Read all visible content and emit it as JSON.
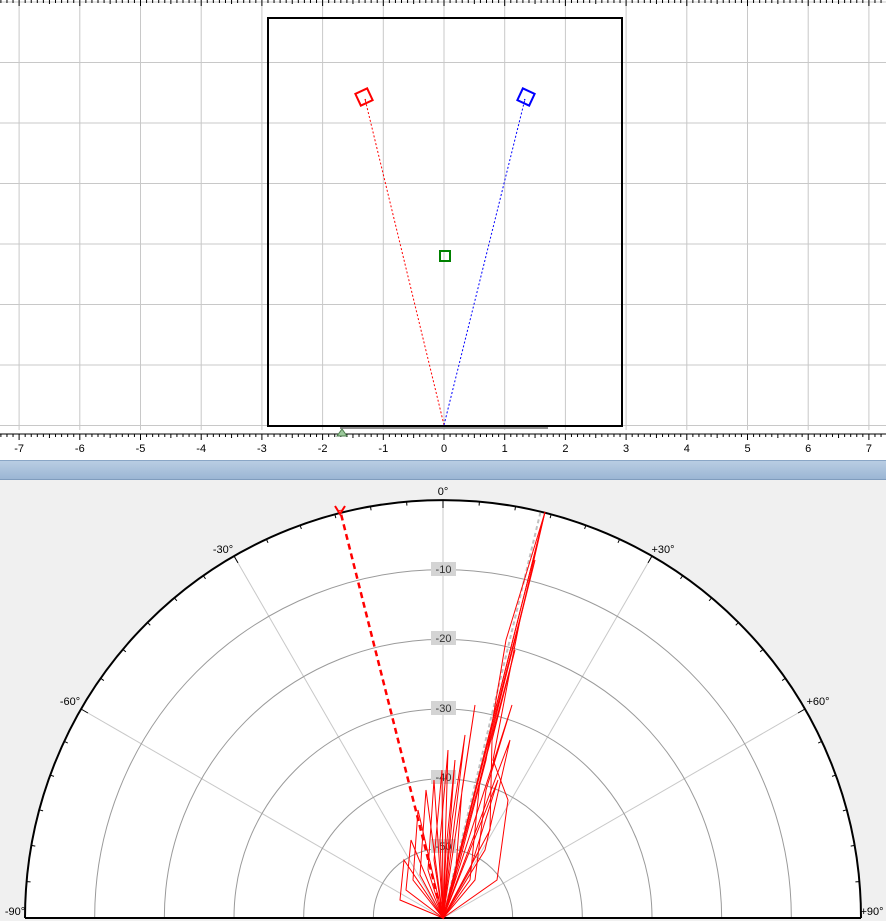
{
  "top_view": {
    "x_axis_ticks": [
      "-7",
      "-6",
      "-5",
      "-4",
      "-3",
      "-2",
      "-1",
      "0",
      "1",
      "2",
      "3",
      "4",
      "5",
      "6",
      "7"
    ],
    "colors": {
      "left_speaker": "#ff0000",
      "right_speaker": "#0000ff",
      "listener": "#008000",
      "room_border": "#000000",
      "grid": "#c8c8c8"
    },
    "icons": [
      "speaker-left-icon",
      "speaker-right-icon",
      "listener-icon",
      "position-marker-icon"
    ]
  },
  "polar_view": {
    "angle_labels": {
      "center": "0°",
      "neg30": "-30°",
      "pos30": "+30°",
      "neg60": "-60°",
      "pos60": "+60°",
      "neg90": "-90°",
      "pos90": "+90°"
    },
    "ring_labels": [
      "-10",
      "-20",
      "-30",
      "-40",
      "-50"
    ],
    "colors": {
      "response": "#ff0000",
      "rings": "#9a9a9a",
      "spokes": "#c8c8c8",
      "outline": "#000000"
    },
    "icons": [
      "target-direction-icon"
    ]
  }
}
